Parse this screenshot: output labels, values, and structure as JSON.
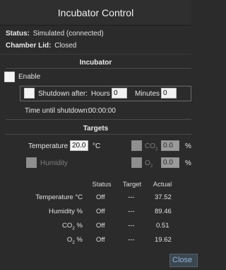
{
  "window": {
    "title": "Incubator Control"
  },
  "status": {
    "status_label": "Status:",
    "status_value": "Simulated (connected)",
    "lid_label": "Chamber Lid:",
    "lid_value": "Closed"
  },
  "incubator": {
    "title": "Incubator",
    "enable_label": "Enable",
    "shutdown_label": "Shutdown after:",
    "hours_label": "Hours",
    "hours_value": "0",
    "minutes_label": "Minutes",
    "minutes_value": "0",
    "time_until_label": "Time until shutdown:",
    "time_until_value": "00:00:00"
  },
  "targets": {
    "title": "Targets",
    "temperature_label": "Temperature",
    "temperature_value": "20.0",
    "temperature_unit": "°C",
    "co2_label": "CO",
    "co2_sub": "2",
    "co2_value": "0.0",
    "co2_unit": "%",
    "humidity_label": "Humidity",
    "o2_label": "O",
    "o2_sub": "2",
    "o2_value": "0.0",
    "o2_unit": "%"
  },
  "readings": {
    "headers": {
      "status": "Status",
      "target": "Target",
      "actual": "Actual"
    },
    "rows": [
      {
        "label": "Temperature °C",
        "status": "Off",
        "target": "---",
        "actual": "37.52"
      },
      {
        "label": "Humidity %",
        "status": "Off",
        "target": "---",
        "actual": "89.46"
      },
      {
        "label": "CO",
        "sub": "2",
        "unit": " %",
        "status": "Off",
        "target": "---",
        "actual": "0.51"
      },
      {
        "label": "O",
        "sub": "2",
        "unit": " %",
        "status": "Off",
        "target": "---",
        "actual": "19.62"
      }
    ]
  },
  "footer": {
    "close_label": "Close"
  }
}
